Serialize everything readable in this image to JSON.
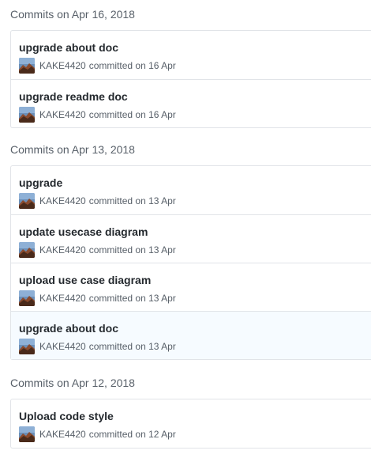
{
  "groups": [
    {
      "heading": "Commits on Apr 16, 2018",
      "commits": [
        {
          "title": "upgrade about doc",
          "author": "KAKE4420",
          "meta": "committed on 16 Apr"
        },
        {
          "title": "upgrade readme doc",
          "author": "KAKE4420",
          "meta": "committed on 16 Apr"
        }
      ]
    },
    {
      "heading": "Commits on Apr 13, 2018",
      "commits": [
        {
          "title": "upgrade",
          "author": "KAKE4420",
          "meta": "committed on 13 Apr"
        },
        {
          "title": "update usecase diagram",
          "author": "KAKE4420",
          "meta": "committed on 13 Apr"
        },
        {
          "title": "upload use case diagram",
          "author": "KAKE4420",
          "meta": "committed on 13 Apr"
        },
        {
          "title": "upgrade about doc",
          "author": "KAKE4420",
          "meta": "committed on 13 Apr"
        }
      ]
    },
    {
      "heading": "Commits on Apr 12, 2018",
      "commits": [
        {
          "title": "Upload code style",
          "author": "KAKE4420",
          "meta": "committed on 12 Apr"
        }
      ]
    }
  ],
  "colors": {
    "heading": "#586069",
    "title": "#24292e",
    "meta": "#586069",
    "border": "#e1e4e8",
    "highlight_row": "#f6fbff"
  },
  "icons": {
    "avatar": "user-avatar-photo"
  }
}
